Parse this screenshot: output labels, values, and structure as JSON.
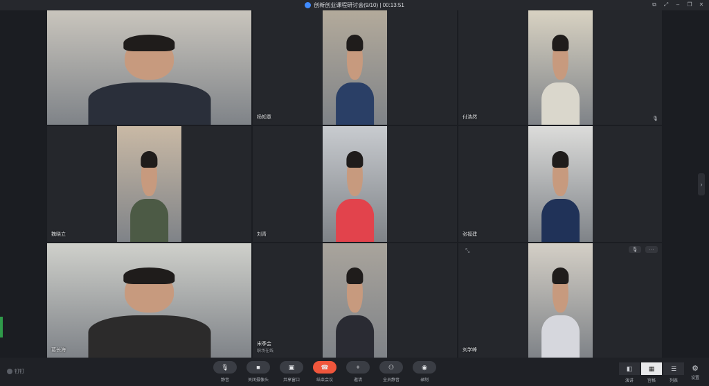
{
  "window": {
    "title": "创新创业课程研讨会(9/10) | 00:13:51"
  },
  "participants": [
    {
      "name": "",
      "layout": "full",
      "shirt": "#2a2f3a",
      "bg": "#c9c5bd"
    },
    {
      "name": "杨知意",
      "layout": "center",
      "shirt": "#2a3f66",
      "bg": "#b3aa9b"
    },
    {
      "name": "付浩然",
      "layout": "center",
      "shirt": "#dad7cc",
      "bg": "#d8d2c2"
    },
    {
      "name": "魏晓立",
      "layout": "center",
      "shirt": "#4c5a45",
      "bg": "#c9b9a5"
    },
    {
      "name": "刘青",
      "layout": "center",
      "shirt": "#e2434c",
      "bg": "#c8cbcf"
    },
    {
      "name": "张福建",
      "layout": "center",
      "shirt": "#203258",
      "bg": "#dcdcda"
    },
    {
      "name": "葛长海",
      "layout": "full",
      "shirt": "#2c2b2b",
      "bg": "#cfd0cb"
    },
    {
      "name": "宋季会",
      "sub": "职场在线",
      "layout": "center",
      "shirt": "#2a2b33",
      "bg": "#a9a49c"
    },
    {
      "name": "刘学峰",
      "layout": "center",
      "shirt": "#d6d7dd",
      "bg": "#d4cfc6"
    }
  ],
  "bottombar": {
    "brand": "钉钉",
    "controls": [
      {
        "label": "静音",
        "icon": "mic-icon",
        "glyph": "🎙"
      },
      {
        "label": "关闭摄像头",
        "icon": "camera-icon",
        "glyph": "■"
      },
      {
        "label": "共享窗口",
        "icon": "screen-share-icon",
        "glyph": "▣"
      },
      {
        "label": "结束会议",
        "icon": "hang-up-icon",
        "glyph": "☎"
      },
      {
        "label": "邀请",
        "icon": "invite-icon",
        "glyph": "+"
      },
      {
        "label": "全员静音",
        "icon": "mute-all-icon",
        "glyph": "⚇"
      },
      {
        "label": "录制",
        "icon": "record-icon",
        "glyph": "◉"
      }
    ],
    "views": [
      {
        "label": "演讲",
        "icon": "speaker-view-icon",
        "glyph": "◧"
      },
      {
        "label": "宫格",
        "icon": "grid-view-icon",
        "glyph": "▦"
      },
      {
        "label": "列表",
        "icon": "list-view-icon",
        "glyph": "☰"
      }
    ],
    "settings_label": "设置"
  }
}
